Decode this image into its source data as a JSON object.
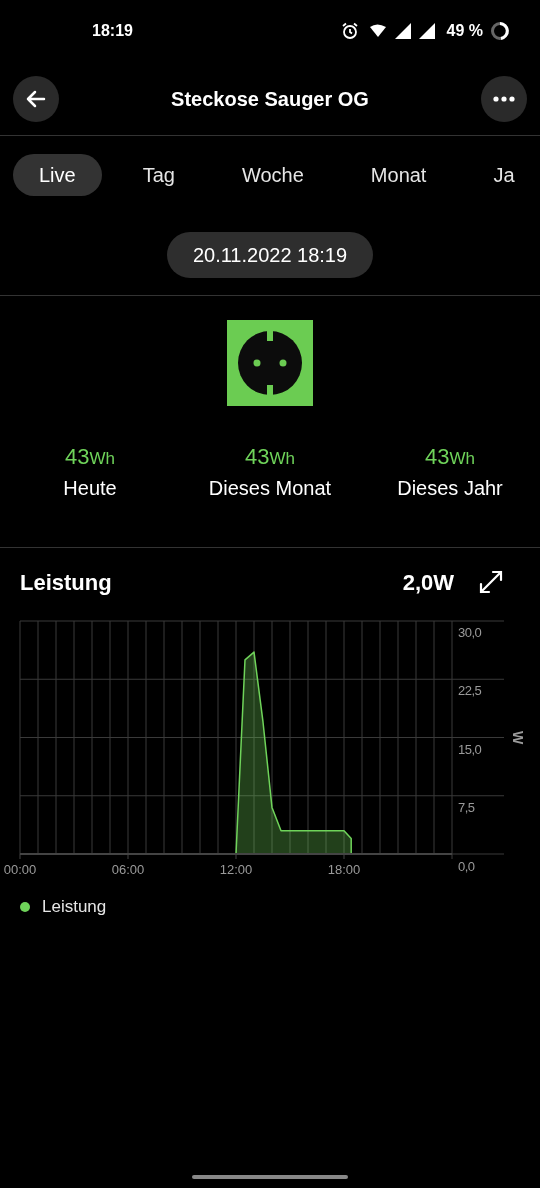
{
  "status_bar": {
    "time": "18:19",
    "battery": "49 %"
  },
  "header": {
    "title": "Steckose Sauger OG"
  },
  "tabs": [
    {
      "label": "Live",
      "selected": true
    },
    {
      "label": "Tag",
      "selected": false
    },
    {
      "label": "Woche",
      "selected": false
    },
    {
      "label": "Monat",
      "selected": false
    },
    {
      "label": "Ja",
      "selected": false
    }
  ],
  "date": "20.11.2022 18:19",
  "stats": [
    {
      "value": "43",
      "unit": "Wh",
      "label": "Heute"
    },
    {
      "value": "43",
      "unit": "Wh",
      "label": "Dieses Monat"
    },
    {
      "value": "43",
      "unit": "Wh",
      "label": "Dieses Jahr"
    }
  ],
  "power": {
    "title": "Leistung",
    "reading": "2,0W",
    "chart_data": {
      "type": "area",
      "ylabel": "W",
      "x": [
        12,
        12.5,
        13,
        13.5,
        14,
        14.5,
        18,
        18.4
      ],
      "series": [
        {
          "name": "Leistung",
          "color": "#6fd35a",
          "values": [
            0,
            25,
            26,
            17,
            6,
            3,
            3,
            2
          ]
        }
      ],
      "xlim": [
        0,
        24
      ],
      "ylim": [
        0,
        30
      ],
      "grid": true,
      "xticks": [
        {
          "value": 0,
          "label": "00:00"
        },
        {
          "value": 6,
          "label": "06:00"
        },
        {
          "value": 12,
          "label": "12:00"
        },
        {
          "value": 18,
          "label": "18:00"
        }
      ],
      "yticks": [
        {
          "value": 0,
          "label": "0,0"
        },
        {
          "value": 7.5,
          "label": "7,5"
        },
        {
          "value": 15,
          "label": "15,0"
        },
        {
          "value": 22.5,
          "label": "22,5"
        },
        {
          "value": 30,
          "label": "30,0"
        }
      ]
    }
  }
}
